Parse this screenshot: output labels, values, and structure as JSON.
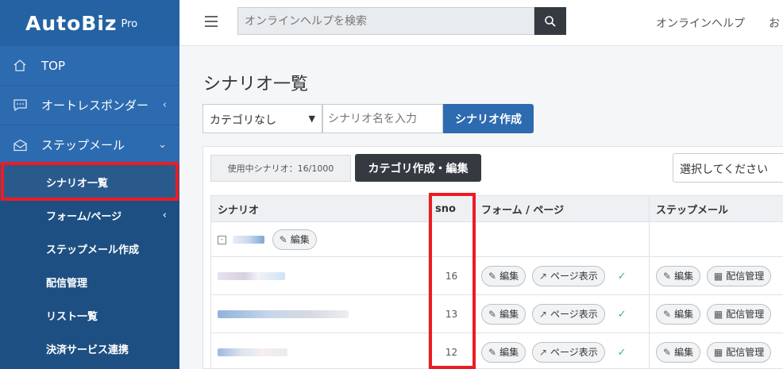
{
  "brand": {
    "name": "AutoBiz",
    "sub": "Pro"
  },
  "sidebar": {
    "top": "TOP",
    "autoresponder": "オートレスポンダー",
    "stepmail": "ステップメール",
    "subitems": [
      "シナリオ一覧",
      "フォーム/ページ",
      "ステップメール作成",
      "配信管理",
      "リスト一覧",
      "決済サービス連携"
    ]
  },
  "header": {
    "search_placeholder": "オンラインヘルプを検索",
    "help": "オンラインヘルプ",
    "cut": "お"
  },
  "page": {
    "title": "シナリオ一覧",
    "category_select": "カテゴリなし",
    "name_placeholder": "シナリオ名を入力",
    "create_button": "シナリオ作成",
    "usage": "使用中シナリオ：16/1000",
    "category_edit_button": "カテゴリ作成・編集",
    "filter_placeholder": "選択してください"
  },
  "table": {
    "headers": [
      "シナリオ",
      "sno",
      "フォーム / ページ",
      "ステップメール"
    ],
    "group_edit": "編集",
    "rows": [
      {
        "sno": "16"
      },
      {
        "sno": "13"
      },
      {
        "sno": "12"
      }
    ],
    "edit_label": "編集",
    "page_view_label": "ページ表示",
    "delivery_label": "配信管理"
  },
  "colors": {
    "accent": "#2d6bb0",
    "sidebar": "#1e4f82",
    "highlight": "#ec1c24"
  }
}
